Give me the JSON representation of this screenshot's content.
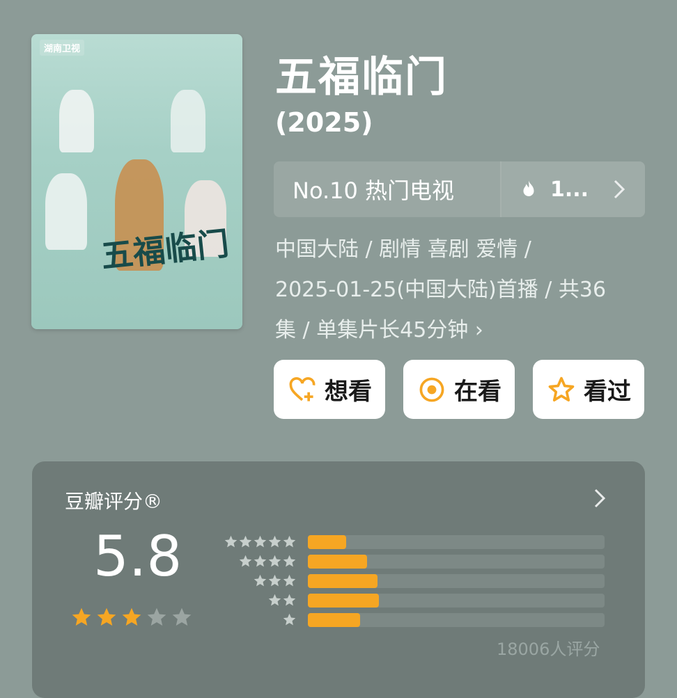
{
  "poster": {
    "logo_text": "湖南卫视",
    "title_text": "五福临门"
  },
  "title": "五福临门",
  "year": "(2025)",
  "rank": {
    "text": "No.10 热门电视",
    "heat_value": "1...",
    "icon": "flame-icon"
  },
  "meta": {
    "line1": "中国大陆 / 剧情 喜剧 爱情 /",
    "line2": "2025-01-25(中国大陆)首播 / 共36",
    "line3": "集 / 单集片长45分钟 ›"
  },
  "actions": [
    {
      "label": "想看",
      "icon": "heart-plus-icon"
    },
    {
      "label": "在看",
      "icon": "target-icon"
    },
    {
      "label": "看过",
      "icon": "star-outline-icon"
    }
  ],
  "rating": {
    "label": "豆瓣评分®",
    "score": "5.8",
    "stars_filled": 3,
    "stars_total": 5,
    "count": "18006人评分",
    "distribution": [
      {
        "stars": 5,
        "fraction": 0.13
      },
      {
        "stars": 4,
        "fraction": 0.2
      },
      {
        "stars": 3,
        "fraction": 0.235
      },
      {
        "stars": 2,
        "fraction": 0.24
      },
      {
        "stars": 1,
        "fraction": 0.175
      }
    ]
  },
  "colors": {
    "background": "#8c9b97",
    "card": "#6f7b78",
    "accent": "#f6a623"
  }
}
